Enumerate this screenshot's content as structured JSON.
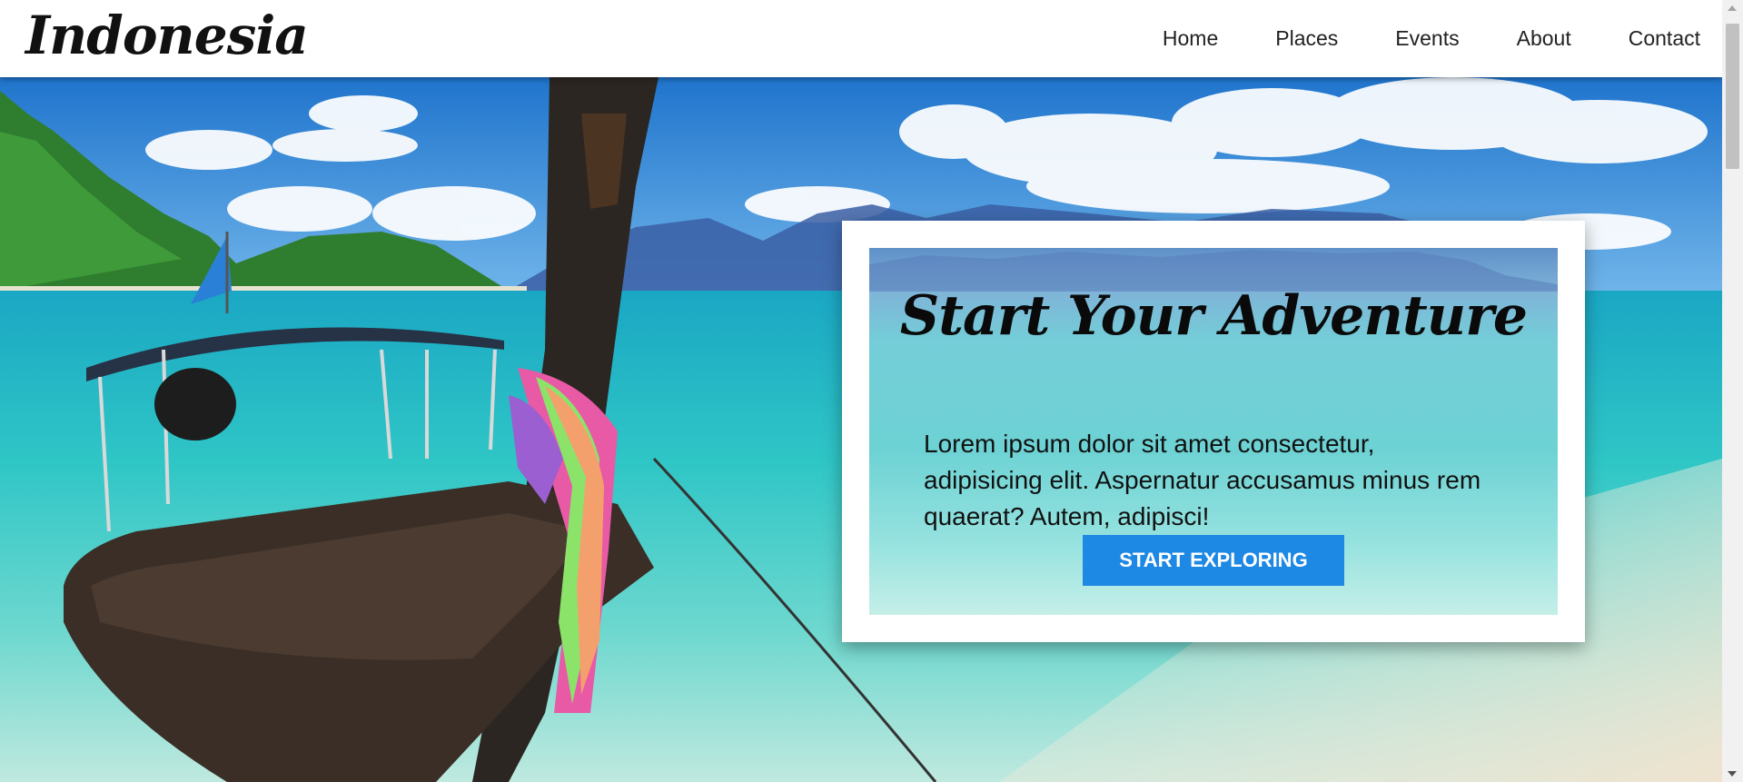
{
  "header": {
    "logo": "Indonesia",
    "nav": [
      {
        "label": "Home"
      },
      {
        "label": "Places"
      },
      {
        "label": "Events"
      },
      {
        "label": "About"
      },
      {
        "label": "Contact"
      }
    ]
  },
  "hero": {
    "card": {
      "title": "Start Your Adventure",
      "text": "Lorem ipsum dolor sit amet consectetur, adipisicing elit. Aspernatur accusamus minus rem quaerat? Autem, adipisci!",
      "button_label": "START EXPLORING"
    }
  },
  "colors": {
    "accent": "#1e88e5",
    "sea": "#3ec9c4",
    "sky": "#2f86d6"
  }
}
